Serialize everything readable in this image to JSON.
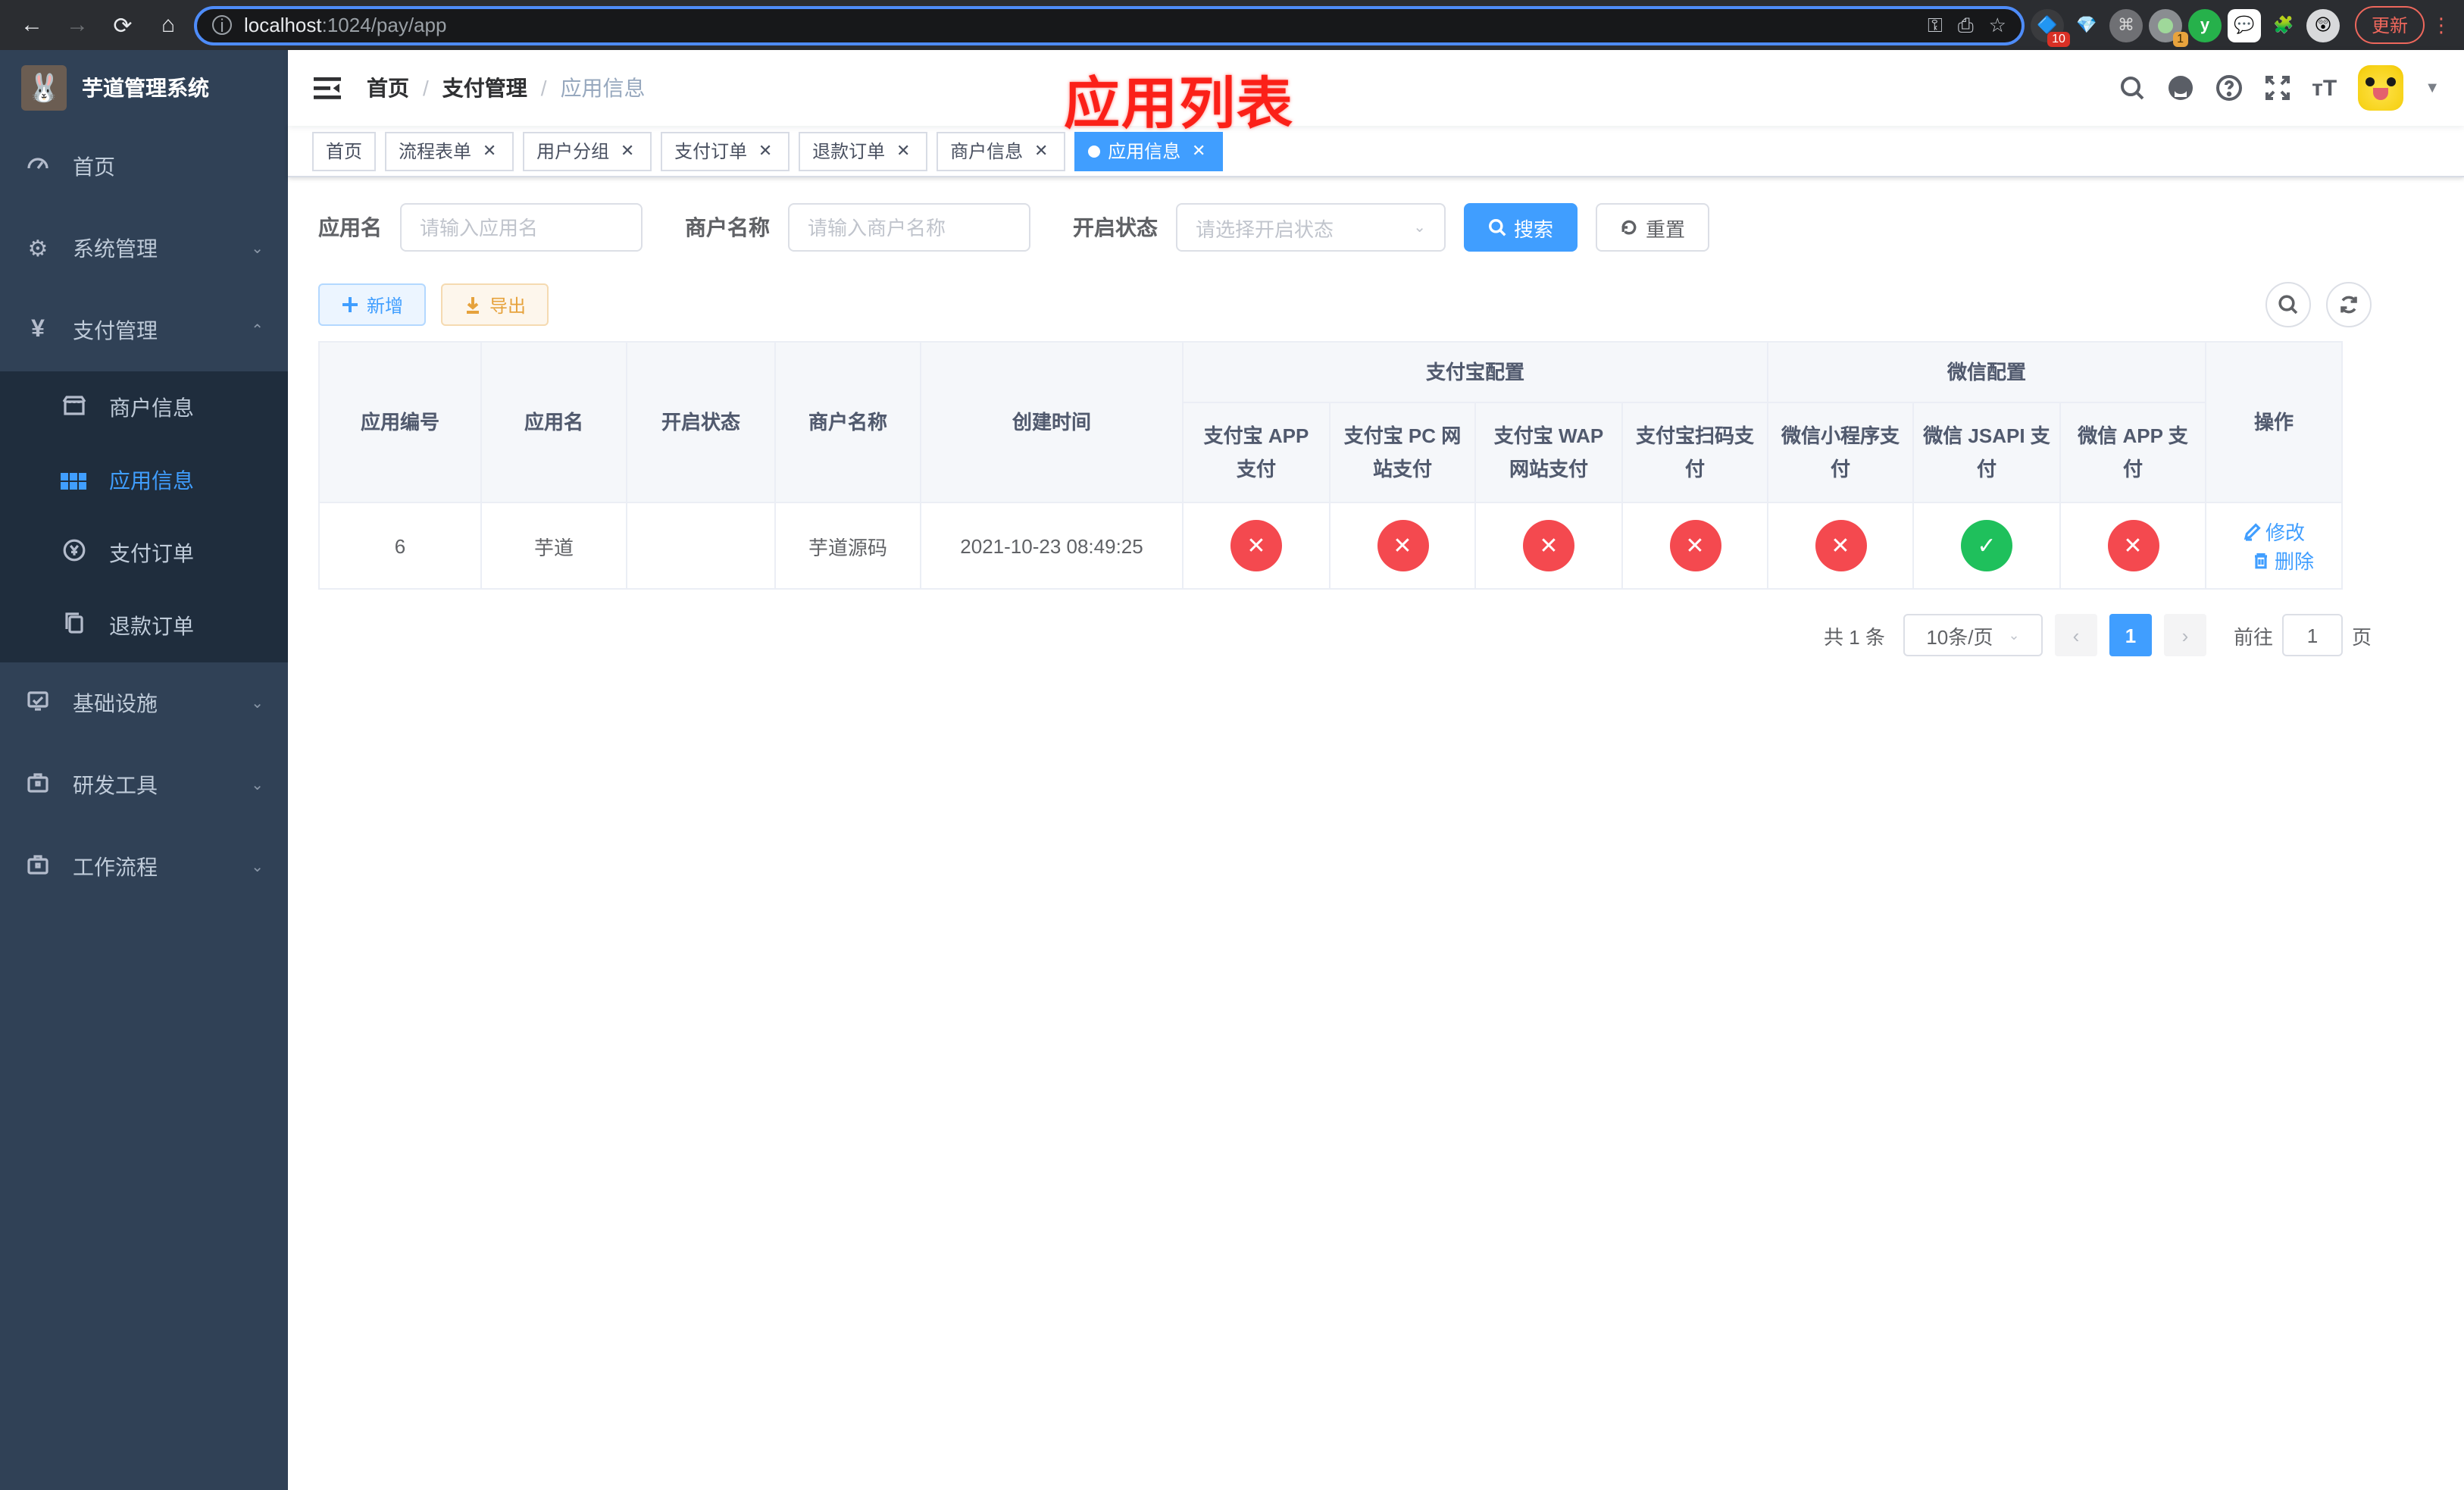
{
  "browser": {
    "url_host": "localhost",
    "url_rest": ":1024/pay/app",
    "update_label": "更新",
    "extensions": {
      "badge_1": "10",
      "badge_2": "1",
      "letter_icon": "y"
    }
  },
  "sidebar": {
    "logo_title": "芋道管理系统",
    "items_top": [
      {
        "label": "首页"
      },
      {
        "label": "系统管理"
      },
      {
        "label": "支付管理"
      }
    ],
    "submenu": [
      {
        "label": "商户信息"
      },
      {
        "label": "应用信息",
        "active": true
      },
      {
        "label": "支付订单"
      },
      {
        "label": "退款订单"
      }
    ],
    "items_bottom": [
      {
        "label": "基础设施"
      },
      {
        "label": "研发工具"
      },
      {
        "label": "工作流程"
      }
    ]
  },
  "navbar": {
    "breadcrumb": [
      {
        "label": "首页"
      },
      {
        "label": "支付管理"
      },
      {
        "label": "应用信息"
      }
    ],
    "separator": "/",
    "annotation": "应用列表"
  },
  "tags": [
    {
      "label": "首页",
      "closable": false,
      "active": false
    },
    {
      "label": "流程表单",
      "closable": true,
      "active": false
    },
    {
      "label": "用户分组",
      "closable": true,
      "active": false
    },
    {
      "label": "支付订单",
      "closable": true,
      "active": false
    },
    {
      "label": "退款订单",
      "closable": true,
      "active": false
    },
    {
      "label": "商户信息",
      "closable": true,
      "active": false
    },
    {
      "label": "应用信息",
      "closable": true,
      "active": true
    }
  ],
  "filters": {
    "app_name_label": "应用名",
    "app_name_placeholder": "请输入应用名",
    "merchant_label": "商户名称",
    "merchant_placeholder": "请输入商户名称",
    "status_label": "开启状态",
    "status_placeholder": "请选择开启状态",
    "search_label": "搜索",
    "reset_label": "重置"
  },
  "toolbar": {
    "add_label": "新增",
    "export_label": "导出"
  },
  "table": {
    "group_headers": [
      {
        "label": "支付宝配置"
      },
      {
        "label": "微信配置"
      }
    ],
    "plain_columns": [
      "应用编号",
      "应用名",
      "开启状态",
      "商户名称",
      "创建时间"
    ],
    "sub_columns": [
      "支付宝 APP 支付",
      "支付宝 PC 网站支付",
      "支付宝 WAP 网站支付",
      "支付宝扫码支付",
      "微信小程序支付",
      "微信 JSAPI 支付",
      "微信 APP 支付"
    ],
    "action_column": "操作",
    "rows": [
      {
        "id": "6",
        "name": "芋道",
        "enabled": true,
        "merchant": "芋道源码",
        "created": "2021-10-23 08:49:25",
        "configs": [
          "no",
          "no",
          "no",
          "no",
          "no",
          "yes",
          "no"
        ],
        "edit_label": "修改",
        "delete_label": "删除"
      }
    ]
  },
  "pagination": {
    "total_label": "共 1 条",
    "page_size": "10条/页",
    "current_page": "1",
    "goto_label": "前往",
    "goto_value": "1",
    "page_suffix": "页"
  }
}
